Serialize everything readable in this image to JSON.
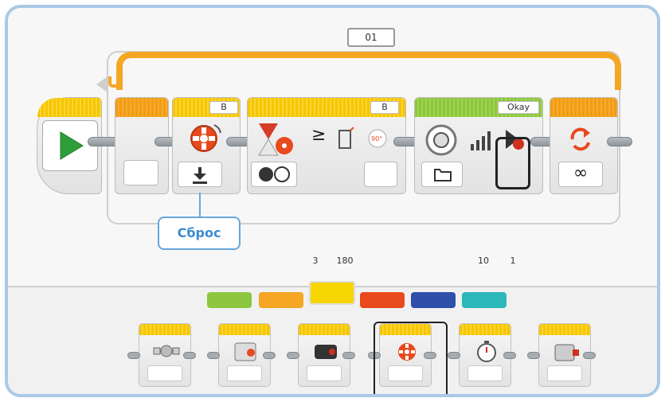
{
  "loop": {
    "name": "01",
    "mode": "infinity"
  },
  "blocks": {
    "start": {
      "icon": "play-icon"
    },
    "wait_empty": {
      "icon": "wait-icon"
    },
    "motor_rotation_reset": {
      "port": "B",
      "icon": "motor-rotation-icon",
      "mode_icon": "reset-icon"
    },
    "wait_compare": {
      "port": "B",
      "compare_symbol": "≥",
      "compare_type": "3",
      "threshold": "180",
      "unit_icon": "degrees-icon"
    },
    "sound": {
      "file": "Okay",
      "volume": "10",
      "play_type": "1"
    },
    "loop_interrupt": {
      "symbol": "∞"
    }
  },
  "callout": {
    "label": "Сброс"
  },
  "palette": {
    "tabs": [
      {
        "name": "action",
        "color": "#8dc63f"
      },
      {
        "name": "flow",
        "color": "#f5a623"
      },
      {
        "name": "sensor",
        "color": "#f7d500"
      },
      {
        "name": "data",
        "color": "#e8491d"
      },
      {
        "name": "advanced",
        "color": "#2f4fa8"
      },
      {
        "name": "myblocks",
        "color": "#2cb8b8"
      }
    ],
    "selected_tab": "sensor",
    "items": [
      {
        "name": "brick-buttons",
        "icon": "brick-buttons-icon"
      },
      {
        "name": "color-sensor",
        "icon": "color-sensor-icon"
      },
      {
        "name": "ir-sensor",
        "icon": "ir-sensor-icon"
      },
      {
        "name": "motor-rotation",
        "icon": "motor-rotation-icon"
      },
      {
        "name": "timer",
        "icon": "timer-icon"
      },
      {
        "name": "touch-sensor",
        "icon": "touch-sensor-icon"
      }
    ],
    "selected_item": "motor-rotation"
  },
  "colors": {
    "frame": "#a9c9e6",
    "loop": "#f5a623",
    "callout": "#3d8bcf"
  }
}
